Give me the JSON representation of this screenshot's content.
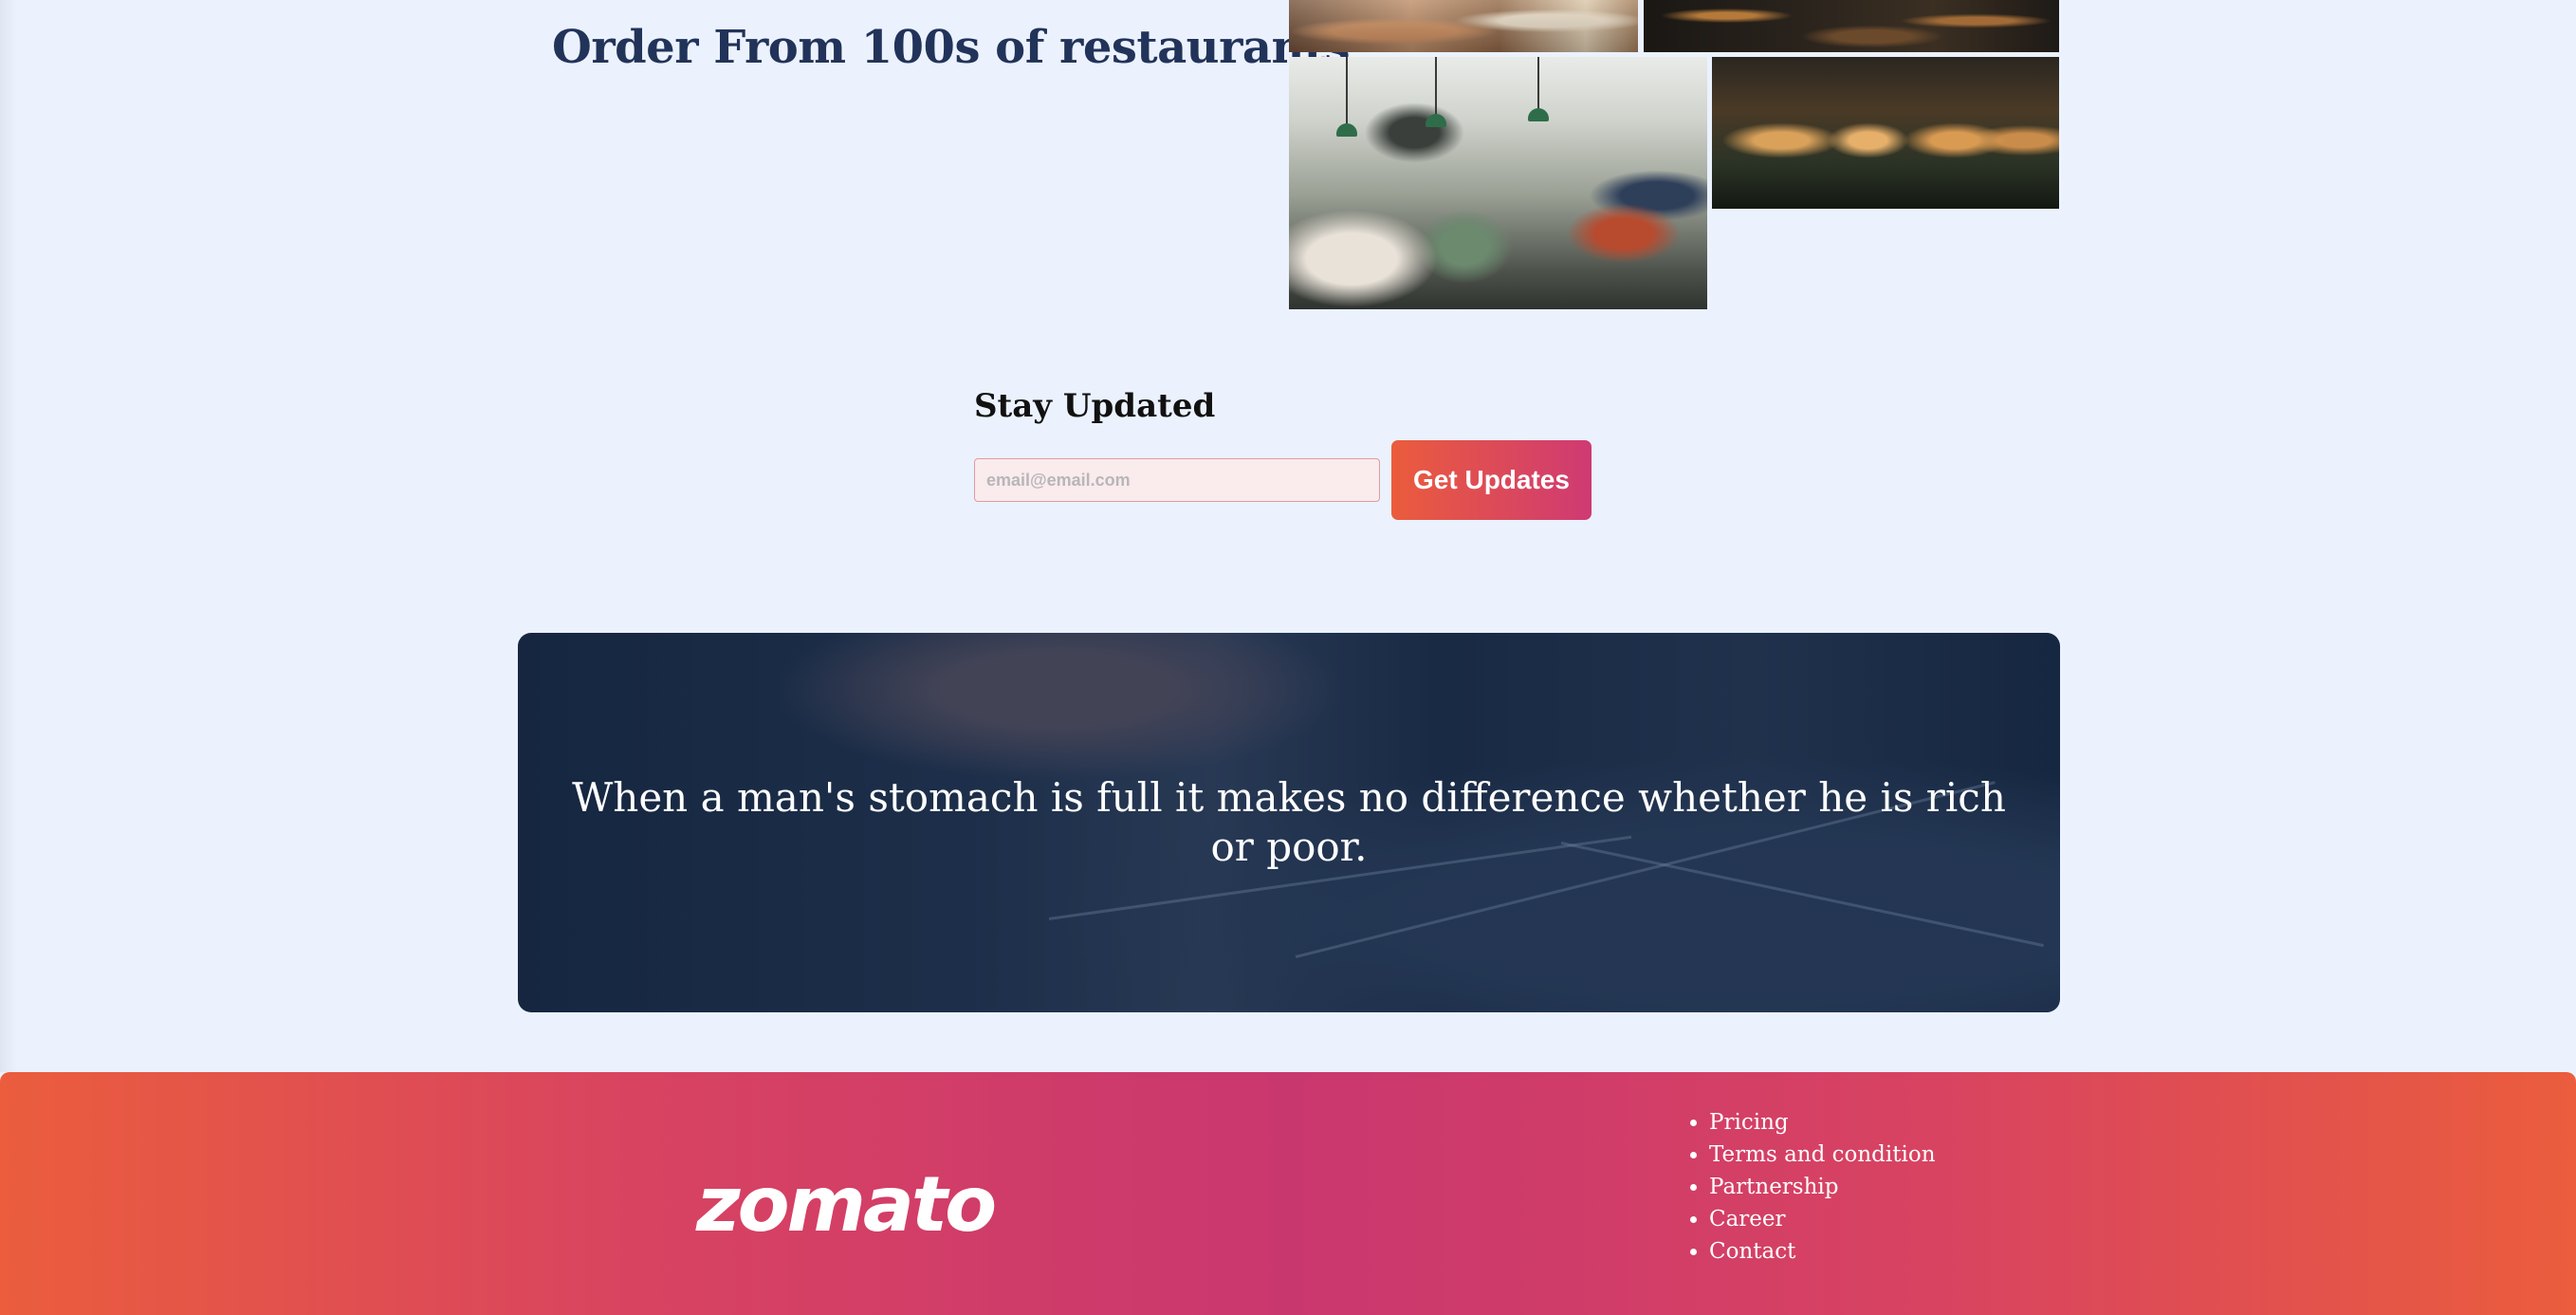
{
  "restaurants": {
    "title": "Order From 100s of restaurants"
  },
  "newsletter": {
    "title": "Stay Updated",
    "email_placeholder": "email@email.com",
    "email_value": "",
    "button_label": "Get Updates"
  },
  "quote": {
    "text": "When a man's stomach is full it makes no difference whether he is rich or poor."
  },
  "footer": {
    "logo_text": "zomato",
    "links": [
      {
        "label": "Pricing"
      },
      {
        "label": "Terms and condition"
      },
      {
        "label": "Partnership"
      },
      {
        "label": "Career"
      },
      {
        "label": "Contact"
      }
    ]
  },
  "colors": {
    "page_background": "#ebf2fd",
    "heading": "#22335a",
    "button_gradient_start": "#eb5c3c",
    "button_gradient_end": "#cf3a73",
    "footer_gradient_edge": "#eb5d3d",
    "footer_gradient_center": "#c9376f",
    "quote_overlay": "#142848"
  }
}
